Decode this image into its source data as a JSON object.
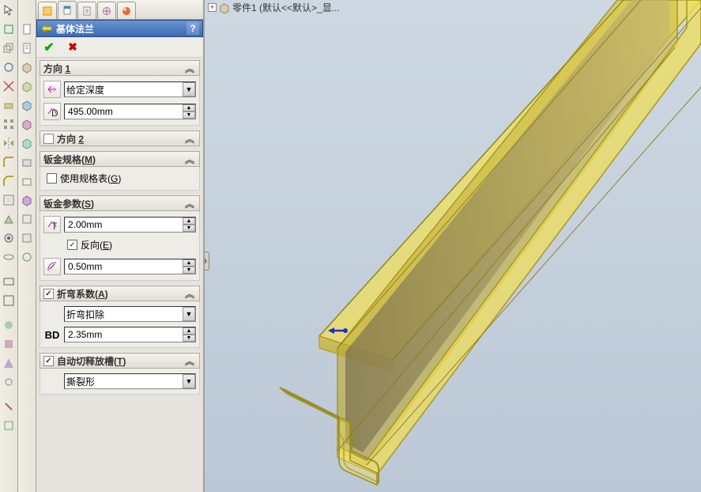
{
  "tree_top": "零件1  (默认<<默认>_显...",
  "panel": {
    "title": "基体法兰",
    "help": "?"
  },
  "sections": {
    "direction1": {
      "title": "方向 1",
      "depth_type": "给定深度",
      "depth_value": "495.00mm"
    },
    "direction2": {
      "title": "方向 2",
      "checked": false
    },
    "sheet_spec": {
      "title": "钣金规格(M)",
      "use_table": "使用规格表(G)",
      "use_table_checked": false
    },
    "sheet_params": {
      "title": "钣金参数(S)",
      "thickness": "2.00mm",
      "reverse": "反向(E)",
      "reverse_checked": true,
      "radius": "0.50mm"
    },
    "bend": {
      "title": "折弯系数(A)",
      "checked": true,
      "type": "折弯扣除",
      "bd_label": "BD",
      "bd_value": "2.35mm"
    },
    "relief": {
      "title": "自动切释放槽(T)",
      "checked": true,
      "type": "撕裂形"
    }
  }
}
